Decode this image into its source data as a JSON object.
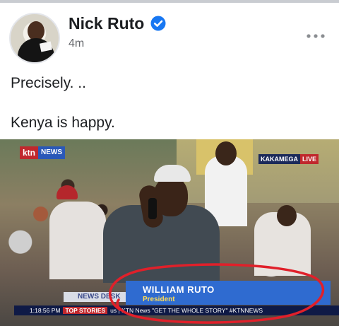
{
  "post": {
    "author": "Nick Ruto",
    "time": "4m",
    "text_line1": "Precisely. ..",
    "text_line2": "Kenya is happy.",
    "verified": true
  },
  "image": {
    "channel_logo": "ktn",
    "channel_sub": "NEWS",
    "location": "KAKAMEGA",
    "live_label": "LIVE",
    "newsdesk": "NEWS DESK",
    "name": "WILLIAM RUTO",
    "title": "President",
    "ticker_time": "1:18:56 PM",
    "ticker_label": "TOP STORIES",
    "ticker_text": "us | KTN News \"GET THE WHOLE STORY\" #KTNNEWS"
  },
  "colors": {
    "verified_blue": "#1877f2",
    "ktn_red": "#c0282d",
    "banner_blue": "#2f6bd0",
    "annotation_red": "#e0202a"
  },
  "icons": {
    "verified": "verified-badge-icon",
    "more": "more-options-icon"
  }
}
